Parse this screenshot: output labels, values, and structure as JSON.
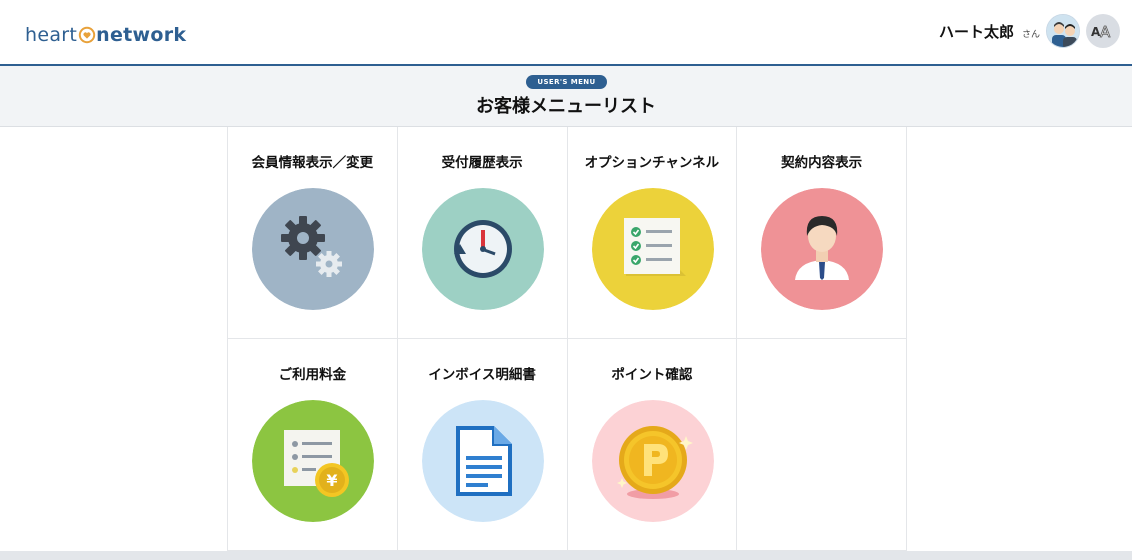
{
  "header": {
    "logo_text_1": "heart",
    "logo_text_2": "network",
    "user_name": "ハート太郎",
    "user_suffix": "さん",
    "font_size_button": "AA"
  },
  "menubar": {
    "badge": "USER'S MENU",
    "title": "お客様メニューリスト"
  },
  "menu": [
    {
      "label": "会員情報表示／変更",
      "icon": "gears-icon",
      "color": "#9fb4c6"
    },
    {
      "label": "受付履歴表示",
      "icon": "clock-history-icon",
      "color": "#9dd0c4"
    },
    {
      "label": "オプションチャンネル",
      "icon": "checklist-icon",
      "color": "#ecd23a"
    },
    {
      "label": "契約内容表示",
      "icon": "person-icon",
      "color": "#ef9296"
    },
    {
      "label": "ご利用料金",
      "icon": "invoice-yen-icon",
      "color": "#8cc541"
    },
    {
      "label": "インボイス明細書",
      "icon": "document-icon",
      "color": "#cce4f7"
    },
    {
      "label": "ポイント確認",
      "icon": "point-coin-icon",
      "color": "#fcd2d5"
    }
  ],
  "colors": {
    "brand": "#2e5f91",
    "menubar_bg": "#f2f4f6"
  }
}
